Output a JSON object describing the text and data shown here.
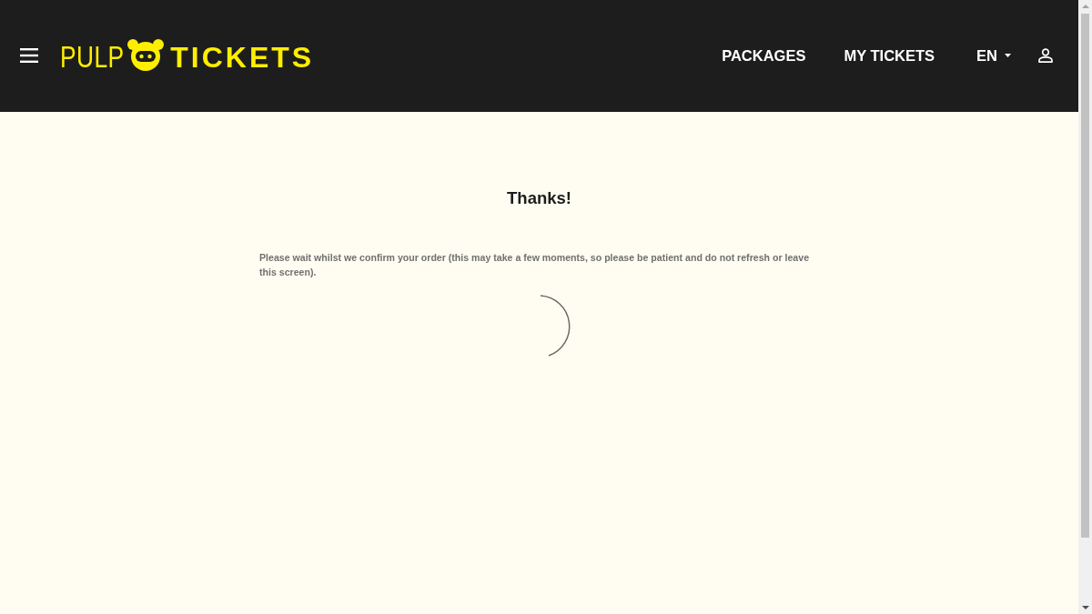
{
  "header": {
    "logo": {
      "light_text": "PULP",
      "bold_text": "TICKETS"
    },
    "nav": [
      {
        "label": "PACKAGES"
      },
      {
        "label": "MY TICKETS"
      }
    ],
    "language": "EN"
  },
  "main": {
    "title": "Thanks!",
    "message": "Please wait whilst we confirm your order (this may take a few moments, so please be patient and do not refresh or leave this screen)."
  }
}
